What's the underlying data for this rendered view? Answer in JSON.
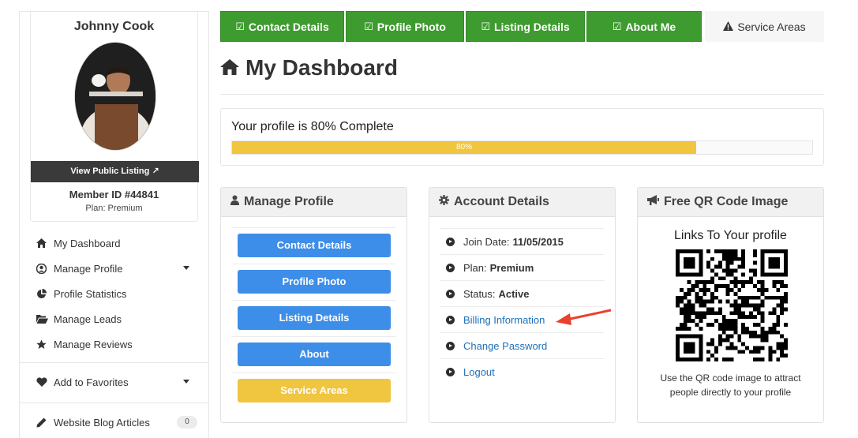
{
  "sidebar": {
    "user_name": "Johnny Cook",
    "view_listing": "View Public Listing",
    "member_id": "Member ID #44841",
    "plan": "Plan: Premium",
    "nav": [
      {
        "label": "My Dashboard",
        "icon": "home-icon"
      },
      {
        "label": "Manage Profile",
        "icon": "user-circle-icon"
      },
      {
        "label": "Profile Statistics",
        "icon": "pie-chart-icon"
      },
      {
        "label": "Manage Leads",
        "icon": "folder-open-icon"
      },
      {
        "label": "Manage Reviews",
        "icon": "star-icon"
      },
      {
        "label": "Add to Favorites",
        "icon": "heart-icon"
      },
      {
        "label": "Website Blog Articles",
        "icon": "pencil-icon",
        "badge": "0"
      }
    ]
  },
  "tabs": [
    {
      "label": "Contact Details",
      "done": true
    },
    {
      "label": "Profile Photo",
      "done": true
    },
    {
      "label": "Listing Details",
      "done": true
    },
    {
      "label": "About Me",
      "done": true
    },
    {
      "label": "Service Areas",
      "done": false
    }
  ],
  "title": "My Dashboard",
  "progress": {
    "text": "Your profile is 80% Complete",
    "percent_label": "80%",
    "value": 0.8
  },
  "manage_profile": {
    "title": "Manage Profile",
    "buttons": [
      "Contact Details",
      "Profile Photo",
      "Listing Details",
      "About",
      "Service Areas"
    ]
  },
  "account": {
    "title": "Account Details",
    "join_label": "Join Date:",
    "join_value": "11/05/2015",
    "plan_label": "Plan:",
    "plan_value": "Premium",
    "status_label": "Status:",
    "status_value": "Active",
    "billing": "Billing Information",
    "change_password": "Change Password",
    "logout": "Logout"
  },
  "qr": {
    "title": "Free QR Code Image",
    "heading": "Links To Your profile",
    "caption": "Use the QR code image to attract people directly to your profile"
  },
  "colors": {
    "green": "#3e9b2f",
    "blue": "#3d8ee8",
    "yellow": "#f0c540",
    "link": "#1d6fb8",
    "arrow": "#e8412c"
  }
}
